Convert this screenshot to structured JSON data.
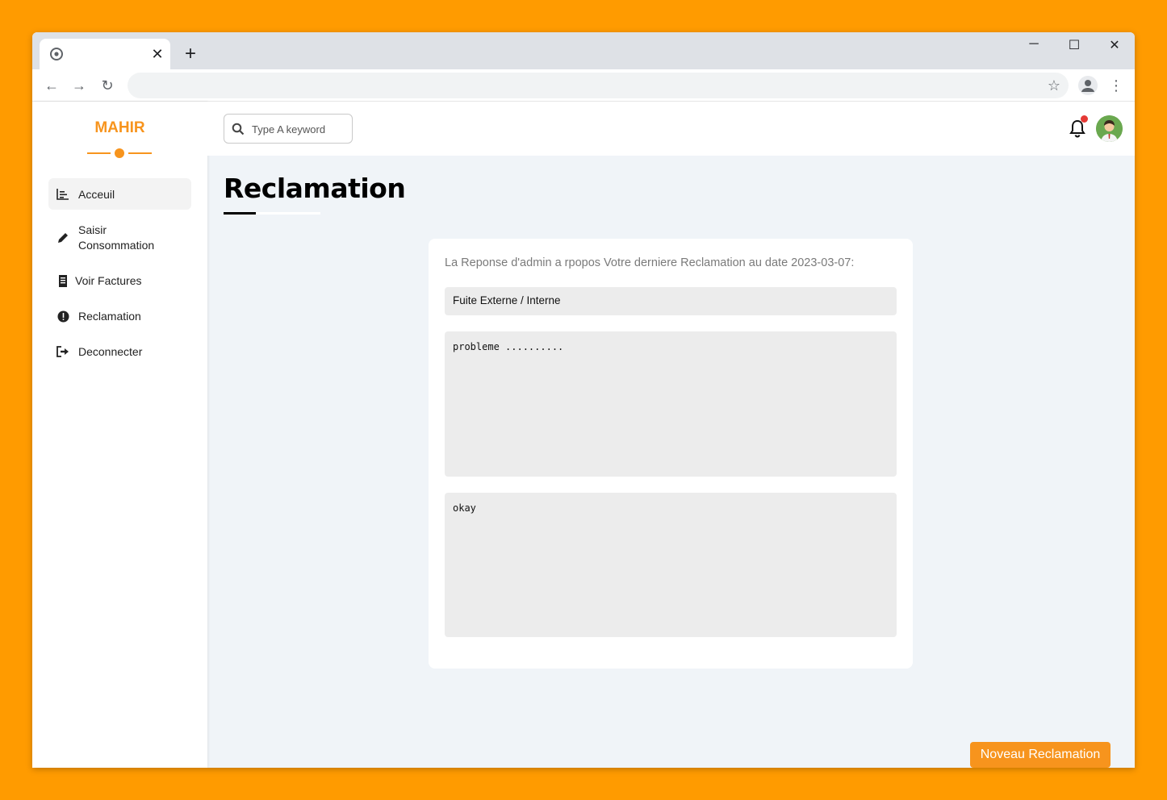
{
  "browser": {
    "tab_close": "✕",
    "new_tab": "+",
    "window_controls": [
      "─",
      "☐",
      "✕"
    ]
  },
  "sidebar": {
    "brand": "MAHIR",
    "items": [
      {
        "label": "Acceuil",
        "icon": "chart-icon",
        "active": true
      },
      {
        "label": "Saisir Consommation",
        "icon": "pencil-icon"
      },
      {
        "label": "Voir Factures",
        "icon": "receipt-icon"
      },
      {
        "label": "Reclamation",
        "icon": "exclamation-circle-icon"
      },
      {
        "label": "Deconnecter",
        "icon": "sign-out-icon"
      }
    ]
  },
  "topbar": {
    "search_placeholder": "Type A keyword"
  },
  "page": {
    "title": "Reclamation"
  },
  "card": {
    "heading": "La Reponse d'admin a rpopos Votre derniere Reclamation au date 2023-03-07:",
    "type_value": "Fuite Externe / Interne",
    "message": "probleme ..........",
    "response": "okay"
  },
  "actions": {
    "new_button": "Noveau Reclamation"
  },
  "colors": {
    "accent": "#f7941d",
    "background": "#ff9b00",
    "notification": "#e53935"
  }
}
